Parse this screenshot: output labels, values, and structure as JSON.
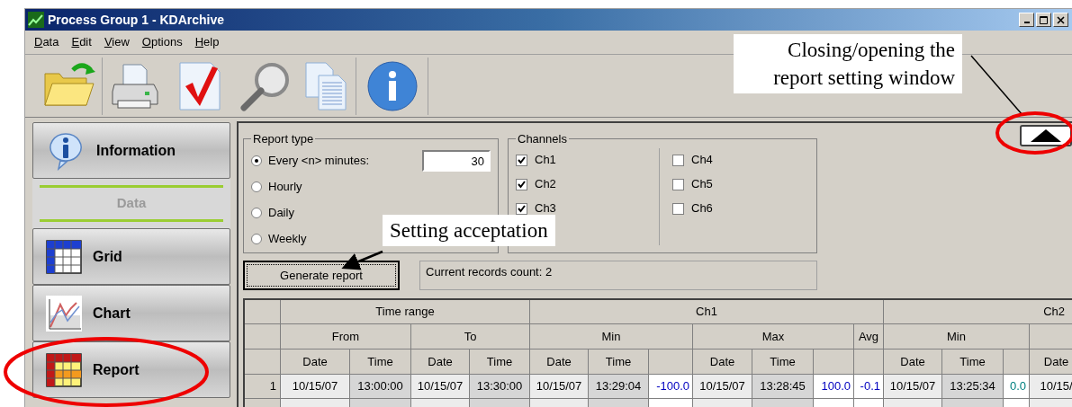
{
  "window": {
    "title": "Process Group 1 - KDArchive"
  },
  "menu": [
    "Data",
    "Edit",
    "View",
    "Options",
    "Help"
  ],
  "sidebar": {
    "items": [
      {
        "kind": "info",
        "label": "Information"
      },
      {
        "kind": "section",
        "label": "Data"
      },
      {
        "kind": "grid",
        "label": "Grid"
      },
      {
        "kind": "chart",
        "label": "Chart"
      },
      {
        "kind": "report",
        "label": "Report"
      }
    ]
  },
  "report_type": {
    "legend": "Report type",
    "minutes_value": "30",
    "options": [
      {
        "label": "Every <n> minutes:",
        "selected": true
      },
      {
        "label": "Hourly",
        "selected": false
      },
      {
        "label": "Daily",
        "selected": false
      },
      {
        "label": "Weekly",
        "selected": false
      }
    ]
  },
  "channels": {
    "legend": "Channels",
    "items": [
      {
        "label": "Ch1",
        "checked": true
      },
      {
        "label": "Ch2",
        "checked": true
      },
      {
        "label": "Ch3",
        "checked": true
      },
      {
        "label": "Ch4",
        "checked": false
      },
      {
        "label": "Ch5",
        "checked": false
      },
      {
        "label": "Ch6",
        "checked": false
      }
    ]
  },
  "generate_button": "Generate report",
  "records_count": "Current records count: 2",
  "table": {
    "header_rows": [
      [
        "Time range",
        "Ch1",
        "Ch2"
      ],
      [
        "From",
        "To",
        "Min",
        "Max",
        "Avg",
        "Min"
      ],
      [
        "Date",
        "Time",
        "Date",
        "Time",
        "Date",
        "Time",
        "Date",
        "Time",
        "Date",
        "Time",
        "Date"
      ]
    ],
    "rows": [
      {
        "number": "1",
        "cells": [
          {
            "kind": "date",
            "text": "10/15/07"
          },
          {
            "kind": "time",
            "text": "13:00:00"
          },
          {
            "kind": "date",
            "text": "10/15/07"
          },
          {
            "kind": "time",
            "text": "13:30:00"
          },
          {
            "kind": "date",
            "text": "10/15/07"
          },
          {
            "kind": "time",
            "text": "13:29:04"
          },
          {
            "kind": "value",
            "text": "-100.0",
            "color": "#0000c0"
          },
          {
            "kind": "date",
            "text": "10/15/07"
          },
          {
            "kind": "time",
            "text": "13:28:45"
          },
          {
            "kind": "value",
            "text": "100.0",
            "color": "#0000c0"
          },
          {
            "kind": "value",
            "text": "-0.1",
            "color": "#0000c0"
          },
          {
            "kind": "date",
            "text": "10/15/07"
          },
          {
            "kind": "time",
            "text": "13:25:34"
          },
          {
            "kind": "value",
            "text": "0.0",
            "color": "#008080"
          },
          {
            "kind": "date",
            "text": "10/15/"
          }
        ]
      }
    ]
  },
  "annotations": [
    {
      "kind": "callout",
      "text": "Closing/opening the report setting window"
    },
    {
      "kind": "callout",
      "text": "Setting acceptation"
    }
  ]
}
